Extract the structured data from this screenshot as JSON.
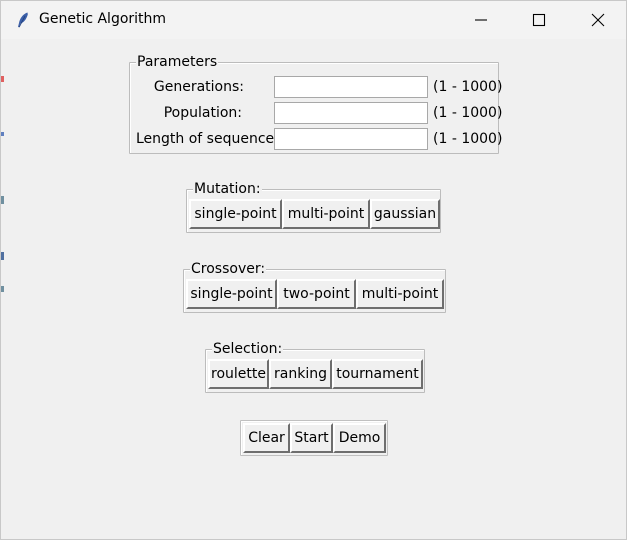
{
  "window": {
    "title": "Genetic Algorithm",
    "icon": "feather-icon",
    "controls": [
      "minimize-icon",
      "maximize-icon",
      "close-icon"
    ]
  },
  "parameters": {
    "title": "Parameters",
    "fields": [
      {
        "label": "Generations:",
        "value": "",
        "range": "(1 - 1000)"
      },
      {
        "label": "Population:",
        "value": "",
        "range": "(1 - 1000)"
      },
      {
        "label": "Length of sequence:",
        "value": "",
        "range": "(1 - 1000)"
      }
    ]
  },
  "mutation": {
    "title": "Mutation:",
    "buttons": [
      "single-point",
      "multi-point",
      "gaussian"
    ]
  },
  "crossover": {
    "title": "Crossover:",
    "buttons": [
      "single-point",
      "two-point",
      "multi-point"
    ]
  },
  "selection": {
    "title": "Selection:",
    "buttons": [
      "roulette",
      "ranking",
      "tournament"
    ]
  },
  "actions": {
    "buttons": [
      "Clear",
      "Start",
      "Demo"
    ]
  }
}
